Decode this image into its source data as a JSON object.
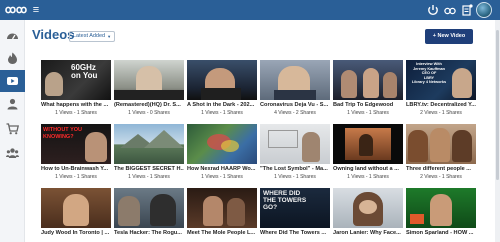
{
  "header": {
    "logo_icon": "infinity-logo-icon",
    "menu_icon": "hamburger-menu-icon",
    "icons": [
      "power-icon",
      "search-icon",
      "notification-icon",
      "user-avatar"
    ]
  },
  "sidebar": {
    "items": [
      {
        "icon": "dashboard-icon",
        "active": false
      },
      {
        "icon": "fire-icon",
        "active": false
      },
      {
        "icon": "video-icon",
        "active": true
      },
      {
        "icon": "user-icon",
        "active": false
      },
      {
        "icon": "cart-icon",
        "active": false
      },
      {
        "icon": "group-icon",
        "active": false
      }
    ]
  },
  "main": {
    "title": "Videos",
    "sort_label": "Latest Added",
    "new_video_label": "+ New Video"
  },
  "videos": [
    {
      "title": "What happens with the ...",
      "meta": "1 Views - 1 Shares",
      "thumb_text": "60GHz\non You"
    },
    {
      "title": "(Remastered)(HQ) Dr. S...",
      "meta": "1 Views - 0 Shares",
      "thumb_text": ""
    },
    {
      "title": "A Shot in the Dark - 202...",
      "meta": "1 Views - 1 Shares",
      "thumb_text": ""
    },
    {
      "title": "Coronavirus Deja Vu - S...",
      "meta": "4 Views - 2 Shares",
      "thumb_text": ""
    },
    {
      "title": "Bad Trip To Edgewood",
      "meta": "1 Views - 1 Shares",
      "thumb_text": ""
    },
    {
      "title": "LBRY.tv: Decentralized Y...",
      "meta": "2 Views - 1 Shares",
      "thumb_text": "Interview With\nJeremy Kauffman\nCEO OF\nLBRY\nLibrary 4 Networks"
    },
    {
      "title": "How to Un-Brainwash Y...",
      "meta": "1 Views - 1 Shares",
      "thumb_text": "WITHOUT YOU\nKNOWING?"
    },
    {
      "title": "The BIGGEST SECRET H...",
      "meta": "1 Views - 1 Shares",
      "thumb_text": ""
    },
    {
      "title": "How Nexrad HAARP Wo...",
      "meta": "1 Views - 1 Shares",
      "thumb_text": ""
    },
    {
      "title": "\"The Lost Symbol\" - Ma...",
      "meta": "1 Views - 1 Shares",
      "thumb_text": ""
    },
    {
      "title": "Owning land without a ...",
      "meta": "1 Views - 1 Shares",
      "thumb_text": ""
    },
    {
      "title": "Three different people ...",
      "meta": "2 Views - 1 Shares",
      "thumb_text": ""
    },
    {
      "title": "Judy Wood In Toronto | ...",
      "meta": "",
      "thumb_text": ""
    },
    {
      "title": "Tesla Hacker: The Rogu...",
      "meta": "",
      "thumb_text": ""
    },
    {
      "title": "Meet The Mole People L...",
      "meta": "",
      "thumb_text": ""
    },
    {
      "title": "Where Did The Towers ...",
      "meta": "",
      "thumb_text": "WHERE DID\nTHE TOWERS\nGO?"
    },
    {
      "title": "Jaron Lanier: Why Face...",
      "meta": "",
      "thumb_text": ""
    },
    {
      "title": "Simon Sparland - HOW ...",
      "meta": "",
      "thumb_text": ""
    }
  ]
}
